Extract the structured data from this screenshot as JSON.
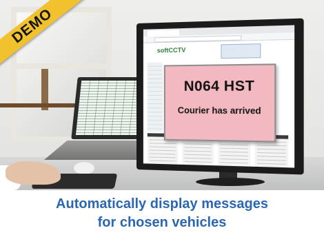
{
  "badge": {
    "label": "DEMO"
  },
  "popup": {
    "plate": "N064 HST",
    "message": "Courier has arrived"
  },
  "site": {
    "logo": "softCCTV"
  },
  "caption": {
    "line1": "Automatically display messages",
    "line2": "for chosen vehicles"
  },
  "colors": {
    "badge": "#f2c22e",
    "popup_background": "#f2b9c0",
    "caption_text": "#2b66b3"
  }
}
